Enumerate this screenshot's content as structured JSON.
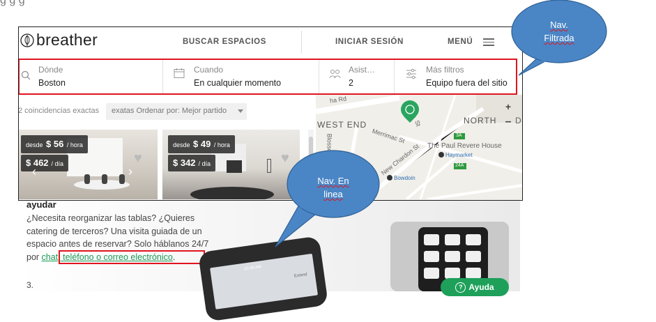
{
  "top_strip": {
    "text": "g                                                         g                                                              g"
  },
  "nav": {
    "logo": "breather",
    "buscar": "BUSCAR ESPACIOS",
    "iniciar": "INICIAR SESIÓN",
    "menu": "MENÚ"
  },
  "filters": {
    "donde_label": "Dónde",
    "donde_value": "Boston",
    "cuando_label": "Cuando",
    "cuando_value": "En cualquier momento",
    "asist_label": "Asist…",
    "asist_value": "2",
    "mas_label": "Más filtros",
    "mas_value": "Equipo fuera del sitio"
  },
  "results": {
    "matches": "2 coincidencias exactas",
    "sort": "exatas Ordenar por:  Mejor partido"
  },
  "listings": [
    {
      "desde": "desde",
      "hour_price": "$ 56",
      "hour_unit": "/ hora",
      "day_price": "$ 462",
      "day_unit": "/ día"
    },
    {
      "desde": "desde",
      "hour_price": "$ 49",
      "hour_unit": "/ hora",
      "day_price": "$ 342",
      "day_unit": "/ día"
    }
  ],
  "map": {
    "labels": [
      "WEST END",
      "NORTH",
      "Merrimac St",
      "New Chardon St",
      "The Paul Revere House",
      "Haymarket",
      "Bowdoin",
      "Blossom",
      "D",
      "24A",
      "3A",
      "ha Rd",
      "St"
    ],
    "zoom_in": "+",
    "zoom_out": "–"
  },
  "help": {
    "title": "ayudar",
    "para_before": "¿Necesita reorganizar las tablas? ¿Quieres catering de terceros? Una visita guiada de un espacio antes de reservar? Solo háblanos 24/7 por ",
    "para_link": "chat, teléfono o correo electrónico",
    "para_after": ".",
    "number": "3.",
    "button": "Ayuda",
    "phone_time": "10:45 AM",
    "phone_extend": "Extend"
  },
  "callouts": {
    "filtered_line1": "Nav.",
    "filtered_line2": "Filtrada",
    "online_line1": "Nav. En",
    "online_line2": "linea"
  },
  "colors": {
    "annotation_red": "#e0141e",
    "callout_blue": "#4a86c5",
    "brand_green": "#1ea05a"
  }
}
